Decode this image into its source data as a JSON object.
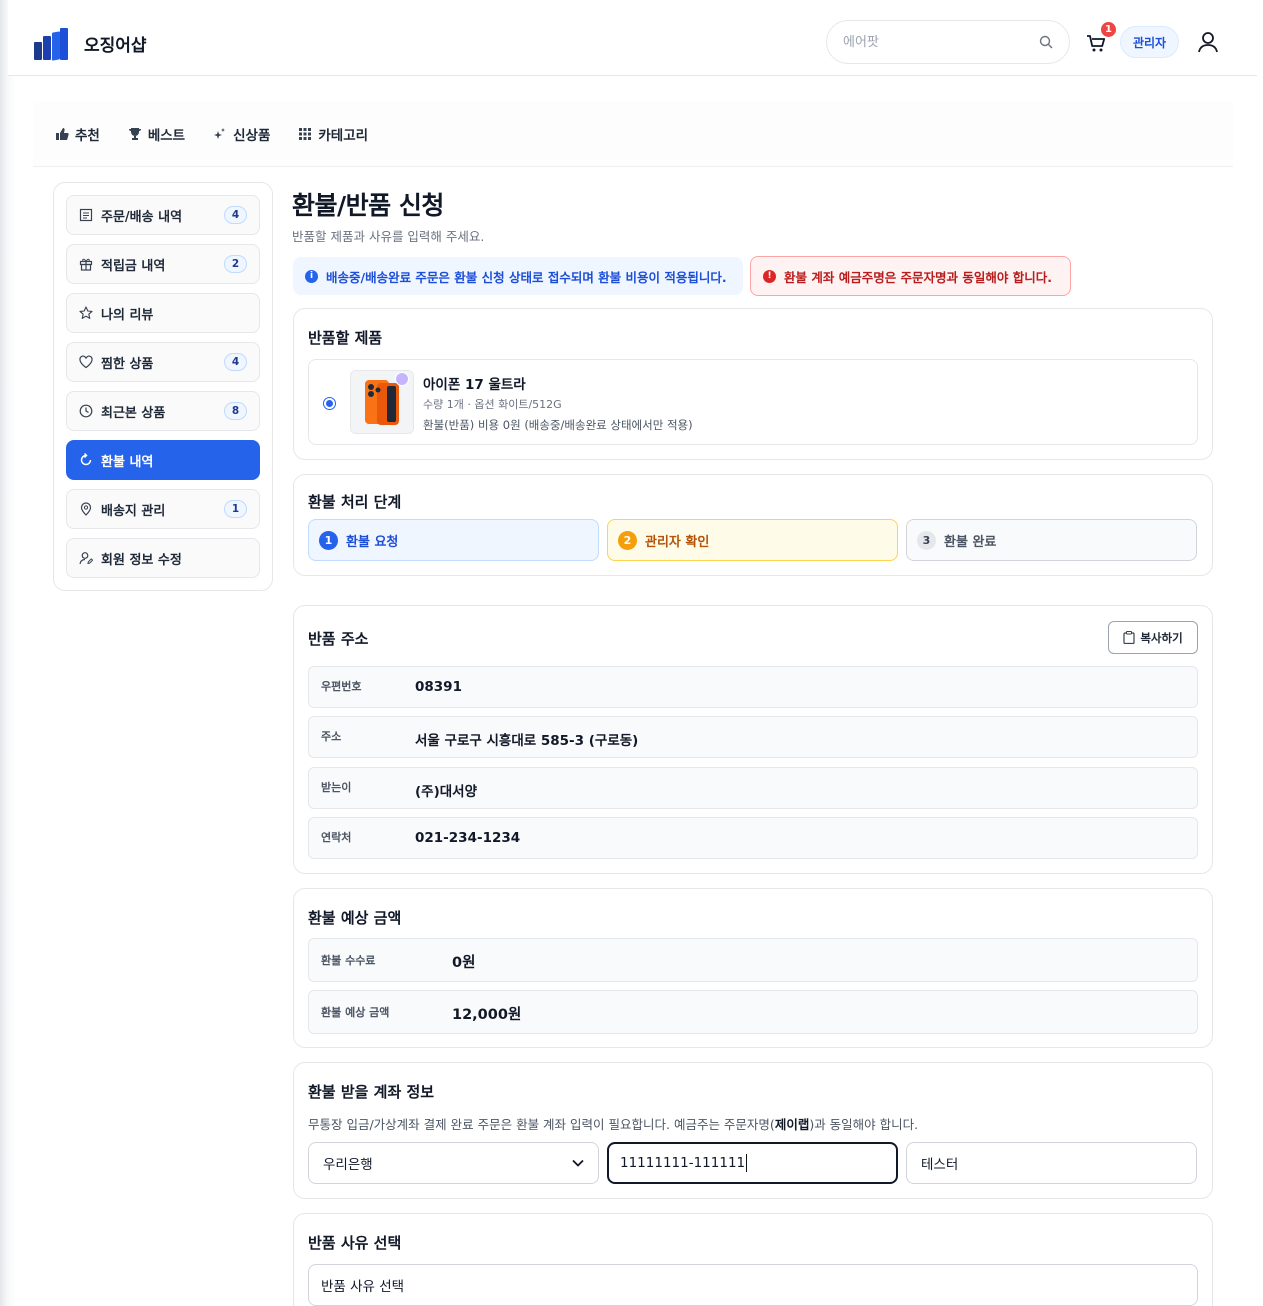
{
  "header": {
    "logo_text": "오징어샵",
    "search_placeholder": "에어팟",
    "cart_count": "1",
    "admin_label": "관리자",
    "brand_color": "#1e3a8a",
    "accent_color": "#2563eb"
  },
  "nav": {
    "items": [
      {
        "label": "추천",
        "icon": "thumbs-up-icon"
      },
      {
        "label": "베스트",
        "icon": "trophy-icon"
      },
      {
        "label": "신상품",
        "icon": "sparkle-icon"
      },
      {
        "label": "카테고리",
        "icon": "grid-icon"
      }
    ]
  },
  "sidebar": {
    "items": [
      {
        "label": "주문/배송 내역",
        "badge": "4",
        "icon": "receipt-icon"
      },
      {
        "label": "적립금 내역",
        "badge": "2",
        "icon": "gift-icon"
      },
      {
        "label": "나의 리뷰",
        "badge": "",
        "icon": "star-icon"
      },
      {
        "label": "찜한 상품",
        "badge": "4",
        "icon": "heart-icon"
      },
      {
        "label": "최근본 상품",
        "badge": "8",
        "icon": "clock-icon"
      },
      {
        "label": "환불 내역",
        "badge": "",
        "icon": "refresh-icon",
        "active": true
      },
      {
        "label": "배송지 관리",
        "badge": "1",
        "icon": "map-pin-icon"
      },
      {
        "label": "회원 정보 수정",
        "badge": "",
        "icon": "user-edit-icon"
      }
    ]
  },
  "main": {
    "title": "환불/반품 신청",
    "subtitle": "반품할 제품과 사유를 입력해 주세요.",
    "notice_info": "배송중/배송완료 주문은 환불 신청 상태로 접수되며 환불 비용이 적용됩니다.",
    "notice_error": "환불 계좌 예금주명은 주문자명과 동일해야 합니다.",
    "product_section": {
      "title": "반품할 제품",
      "name": "아이폰 17 울트라",
      "meta": "수량 1개 · 옵션 화이트/512G",
      "fee_note": "환불(반품) 비용 0원 (배송중/배송완료 상태에서만 적용)"
    },
    "steps_section": {
      "title": "환불 처리 단계",
      "steps": [
        {
          "num": "1",
          "label": "환불 요청"
        },
        {
          "num": "2",
          "label": "관리자 확인"
        },
        {
          "num": "3",
          "label": "환불 완료"
        }
      ]
    },
    "address_section": {
      "title": "반품 주소",
      "copy_label": "복사하기",
      "rows": [
        {
          "key": "우편번호",
          "value": "08391"
        },
        {
          "key": "주소",
          "value": "서울 구로구 시흥대로 585-3 (구로동)"
        },
        {
          "key": "받는이",
          "value": "(주)대서양"
        },
        {
          "key": "연락처",
          "value": "021-234-1234"
        }
      ]
    },
    "amount_section": {
      "title": "환불 예상 금액",
      "rows": [
        {
          "key": "환불 수수료",
          "value": "0원"
        },
        {
          "key": "환불 예상 금액",
          "value": "12,000원"
        }
      ]
    },
    "account_section": {
      "title": "환불 받을 계좌 정보",
      "desc_before": "무통장 입금/가상계좌 결제 완료 주문은 환불 계좌 입력이 필요합니다. 예금주는 주문자명(",
      "desc_name": "제이랩",
      "desc_after": ")과 동일해야 합니다.",
      "bank": "우리은행",
      "account_number": "11111111-111111",
      "holder": "테스터"
    },
    "reason_section": {
      "title": "반품 사유 선택",
      "placeholder": "반품 사유 선택"
    }
  }
}
